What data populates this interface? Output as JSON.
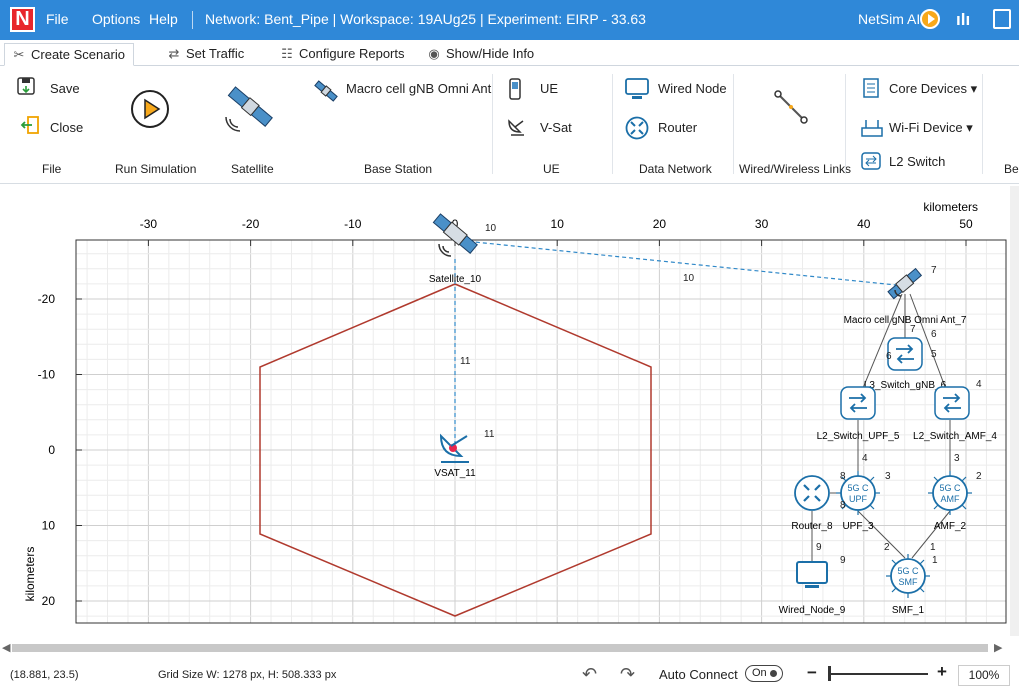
{
  "titlebar": {
    "logo": "N",
    "menu": [
      "File",
      "Options",
      "Help"
    ],
    "title": "Network: Bent_Pipe | Workspace: 19AUg25 | Experiment: EIRP - 33.63",
    "netsim_ai": "NetSim AI",
    "colors": {
      "bar": "#2f88d8",
      "logo": "#e8262b",
      "ai_play": "#f7a81b"
    }
  },
  "tabs": [
    {
      "label": "Create Scenario",
      "icon": "create-scenario-icon",
      "active": true
    },
    {
      "label": "Set Traffic",
      "icon": "set-traffic-icon"
    },
    {
      "label": "Configure Reports",
      "icon": "configure-reports-icon"
    },
    {
      "label": "Show/Hide Info",
      "icon": "show-hide-info-icon"
    }
  ],
  "ribbon": {
    "file": {
      "save": "Save",
      "close": "Close",
      "group": "File"
    },
    "run": {
      "group": "Run Simulation"
    },
    "satellite": {
      "group": "Satellite"
    },
    "base_station": {
      "item": "Macro cell gNB Omni Ant",
      "group": "Base Station"
    },
    "ue": {
      "ue": "UE",
      "vsat": "V-Sat",
      "group": "UE"
    },
    "data_network": {
      "wired_node": "Wired Node",
      "router": "Router",
      "group": "Data Network"
    },
    "links": {
      "group": "Wired/Wireless Links"
    },
    "devices": {
      "core": "Core Devices",
      "wifi": "Wi-Fi Device",
      "l2": "L2 Switch"
    },
    "cut_group": "Bea"
  },
  "canvas": {
    "axis_unit": "kilometers",
    "x_ticks": [
      "-30",
      "-20",
      "-10",
      "0",
      "10",
      "20",
      "30",
      "40",
      "50"
    ],
    "y_ticks": [
      "-20",
      "-10",
      "0",
      "10",
      "20"
    ],
    "nodes": {
      "satellite": "Satellite_10",
      "vsat": "VSAT_11",
      "gnb": "Macro cell gNB Omni Ant_7",
      "l3": "L3_Switch_gNB_6",
      "l2upf": "L2_Switch_UPF_5",
      "l2amf": "L2_Switch_AMF_4",
      "upf": "UPF_3",
      "amf": "AMF_2",
      "router": "Router_8",
      "wired": "Wired_Node_9",
      "smf": "SMF_1"
    },
    "badges": {
      "upf": "5G C\nUPF",
      "amf": "5G C\nAMF",
      "smf": "5G C\nSMF"
    },
    "link_labels": [
      "10",
      "10",
      "11",
      "11",
      "7",
      "6",
      "6",
      "5",
      "4",
      "4",
      "3",
      "3",
      "2",
      "1",
      "1",
      "2",
      "8",
      "8",
      "9",
      "9",
      "7"
    ],
    "colors": {
      "hex": "#b03a2e",
      "link": "#2f88c8",
      "wire": "#555555",
      "device": "#1b6fa8"
    }
  },
  "statusbar": {
    "coords": "(18.881, 23.5)",
    "grid": "Grid Size W: 1278 px, H: 508.333 px",
    "auto_connect": "Auto Connect",
    "toggle": "On",
    "zoom": "100%",
    "minus": "−",
    "plus": "+"
  }
}
